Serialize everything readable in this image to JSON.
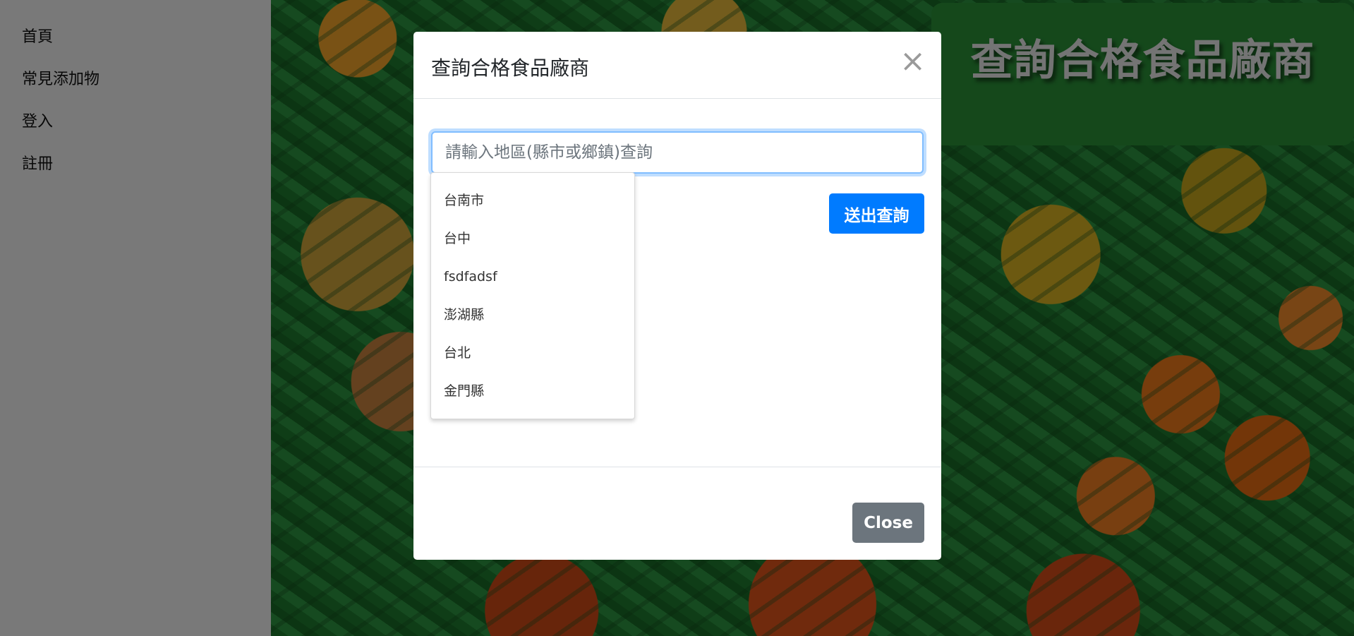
{
  "sidebar": {
    "items": [
      {
        "label": "首頁"
      },
      {
        "label": "常見添加物"
      },
      {
        "label": "登入"
      },
      {
        "label": "註冊"
      }
    ]
  },
  "hero": {
    "title": "查詢合格食品廠商"
  },
  "modal": {
    "title": "查詢合格食品廠商",
    "close_icon": "×",
    "search": {
      "placeholder": "請輸入地區(縣市或鄉鎮)查詢",
      "value": ""
    },
    "submit_label": "送出查詢",
    "suggestions": [
      "台南市",
      "台中",
      "fsdfadsf",
      "澎湖縣",
      "台北",
      "金門縣"
    ],
    "close_label": "Close"
  },
  "colors": {
    "primary": "#007bff",
    "secondary": "#6c757d",
    "hero_bg": "#2a9137"
  }
}
